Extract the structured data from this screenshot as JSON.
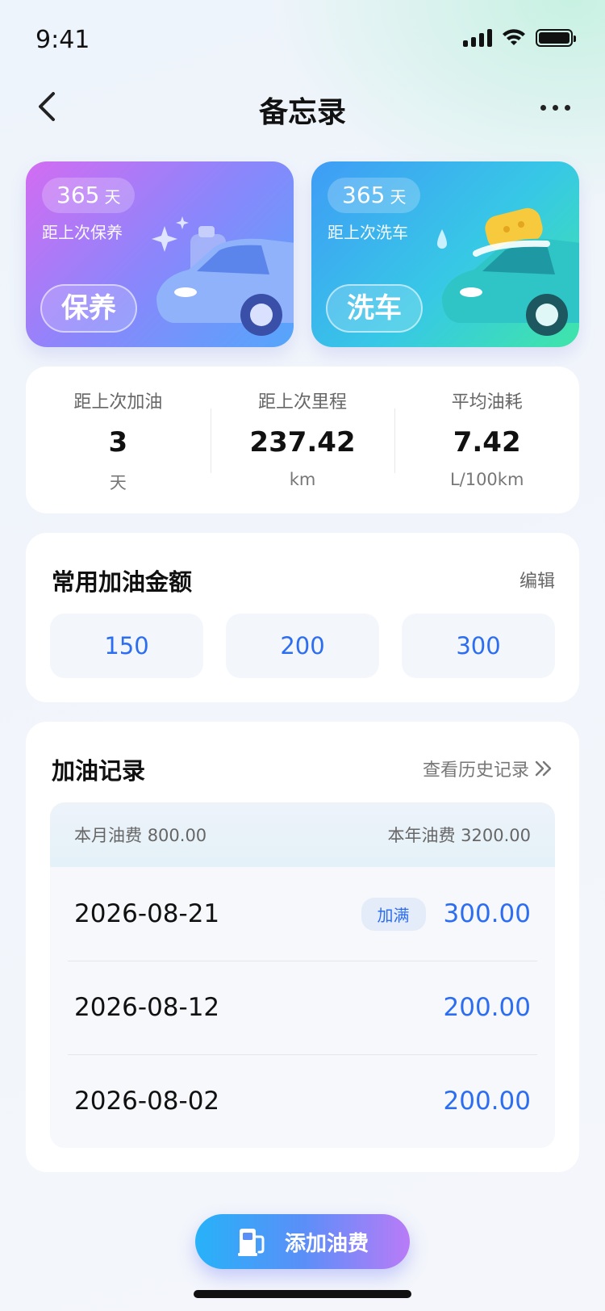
{
  "status_bar": {
    "time": "9:41"
  },
  "nav": {
    "title": "备忘录"
  },
  "cards": {
    "maintenance": {
      "days": "365",
      "unit": "天",
      "since": "距上次保养",
      "action": "保养"
    },
    "wash": {
      "days": "365",
      "unit": "天",
      "since": "距上次洗车",
      "action": "洗车"
    }
  },
  "stats": [
    {
      "label": "距上次加油",
      "value": "3",
      "unit": "天"
    },
    {
      "label": "距上次里程",
      "value": "237.42",
      "unit": "km"
    },
    {
      "label": "平均油耗",
      "value": "7.42",
      "unit": "L/100km"
    }
  ],
  "common_amounts": {
    "title": "常用加油金额",
    "edit": "编辑",
    "values": [
      "150",
      "200",
      "300"
    ]
  },
  "records": {
    "title": "加油记录",
    "history_link": "查看历史记录",
    "month_label": "本月油费",
    "month_value": "800.00",
    "year_label": "本年油费",
    "year_value": "3200.00",
    "items": [
      {
        "date": "2026-08-21",
        "badge": "加满",
        "amount": "300.00"
      },
      {
        "date": "2026-08-12",
        "amount": "200.00"
      },
      {
        "date": "2026-08-02",
        "amount": "200.00"
      }
    ]
  },
  "add_button": {
    "label": "添加油费"
  },
  "colors": {
    "accent_blue": "#2d6ef0",
    "maint_gradient": [
      "#d36cf2",
      "#54a6fb"
    ],
    "wash_gradient": [
      "#3f9cf6",
      "#3fe5a8"
    ]
  }
}
